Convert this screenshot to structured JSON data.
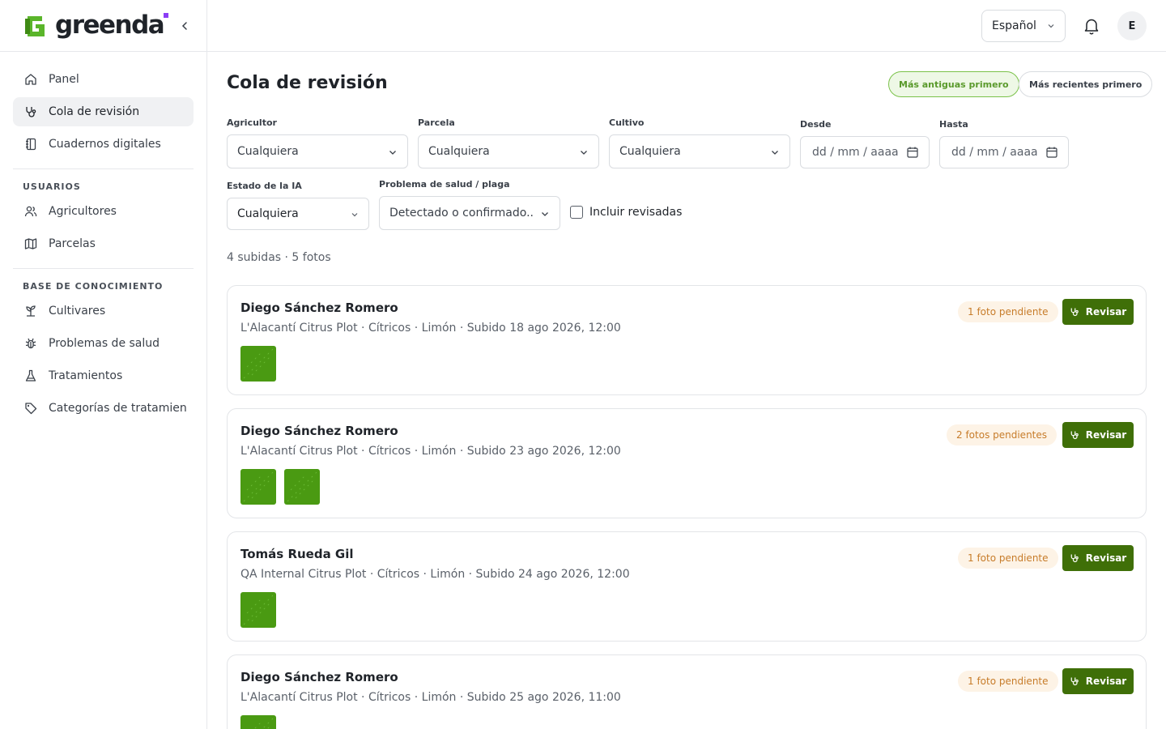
{
  "brand": {
    "name": "greenda",
    "accent": "#4a9a12",
    "logo_green": "#5ab52a",
    "dot_color": "#8b3df5"
  },
  "sidebar": {
    "main_items": [
      {
        "label": "Panel",
        "icon": "home-icon"
      },
      {
        "label": "Cola de revisión",
        "icon": "stethoscope-icon",
        "active": true
      },
      {
        "label": "Cuadernos digitales",
        "icon": "notebook-icon"
      }
    ],
    "sections": [
      {
        "title": "USUARIOS",
        "items": [
          {
            "label": "Agricultores",
            "icon": "users-icon"
          },
          {
            "label": "Parcelas",
            "icon": "map-icon"
          }
        ]
      },
      {
        "title": "BASE DE CONOCIMIENTO",
        "items": [
          {
            "label": "Cultivares",
            "icon": "sprout-icon"
          },
          {
            "label": "Problemas de salud",
            "icon": "bug-icon"
          },
          {
            "label": "Tratamientos",
            "icon": "flask-icon"
          },
          {
            "label": "Categorías de tratamien",
            "icon": "tag-icon"
          }
        ]
      }
    ]
  },
  "header": {
    "language": "Español",
    "avatar_initial": "E"
  },
  "page": {
    "title": "Cola de revisión",
    "sort_oldest": "Más antiguas primero",
    "sort_newest": "Más recientes primero"
  },
  "filters": {
    "farmer": {
      "label": "Agricultor",
      "value": "Cualquiera"
    },
    "plot": {
      "label": "Parcela",
      "value": "Cualquiera"
    },
    "crop": {
      "label": "Cultivo",
      "value": "Cualquiera"
    },
    "from": {
      "label": "Desde",
      "placeholder": "dd / mm / aaaa"
    },
    "to": {
      "label": "Hasta",
      "placeholder": "dd / mm / aaaa"
    },
    "ai_status": {
      "label": "Estado de la IA",
      "value": "Cualquiera"
    },
    "health_issue": {
      "label": "Problema de salud / plaga",
      "value": "Detectado o confirmado.."
    },
    "include_reviewed": "Incluir revisadas"
  },
  "summary": "4 subidas · 5 fotos",
  "review_label": "Revisar",
  "uploads": [
    {
      "farmer": "Diego Sánchez Romero",
      "meta": "L'Alacantí Citrus Plot · Cítricos · Limón · Subido 18 ago 2026, 12:00",
      "pending": "1 foto pendiente",
      "photos": 1
    },
    {
      "farmer": "Diego Sánchez Romero",
      "meta": "L'Alacantí Citrus Plot · Cítricos · Limón · Subido 23 ago 2026, 12:00",
      "pending": "2 fotos pendientes",
      "photos": 2
    },
    {
      "farmer": "Tomás Rueda Gil",
      "meta": "QA Internal Citrus Plot · Cítricos · Limón · Subido 24 ago 2026, 12:00",
      "pending": "1 foto pendiente",
      "photos": 1
    },
    {
      "farmer": "Diego Sánchez Romero",
      "meta": "L'Alacantí Citrus Plot · Cítricos · Limón · Subido 25 ago 2026, 11:00",
      "pending": "1 foto pendiente",
      "photos": 1
    }
  ]
}
